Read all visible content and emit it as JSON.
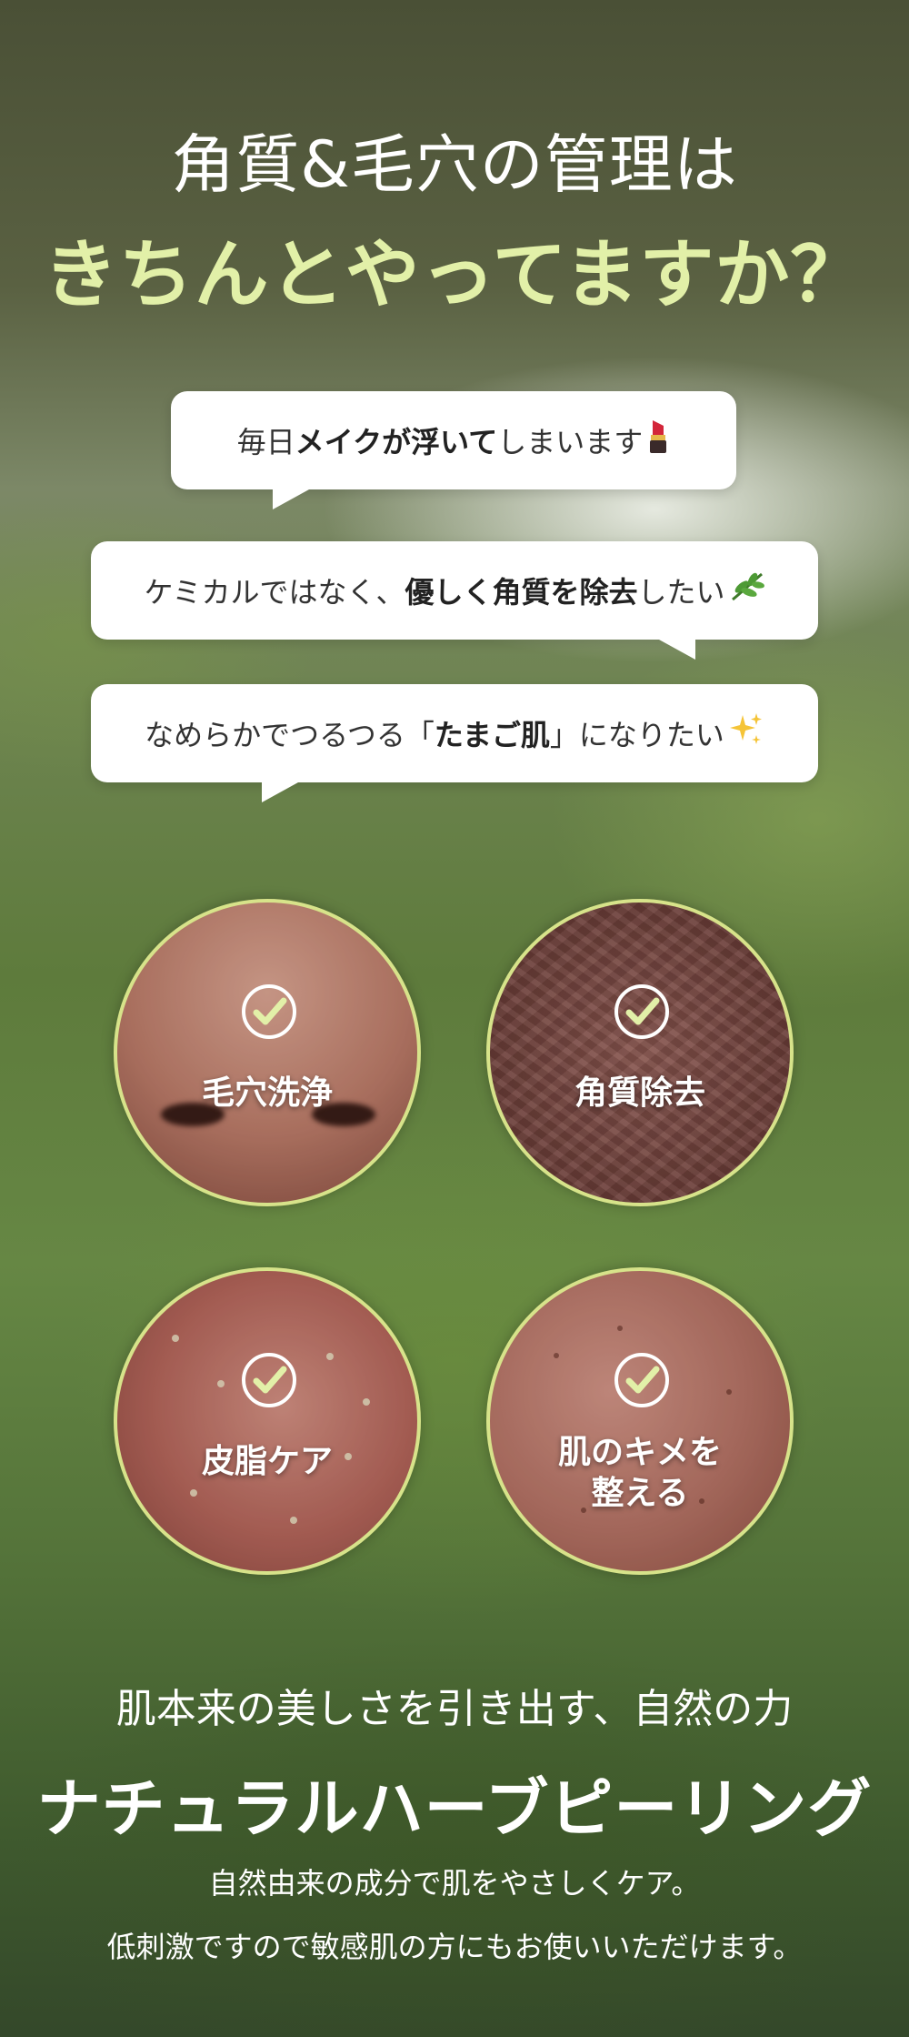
{
  "header": {
    "line1": "角質&毛穴の管理は",
    "line2": "きちんとやってますか？"
  },
  "bubbles": [
    {
      "pre": "毎日",
      "bold": "メイクが浮いて",
      "post": "しまいます",
      "emoji": "lipstick-icon"
    },
    {
      "pre": "ケミカルではなく、",
      "bold": "優しく角質を除去",
      "post": "したい",
      "emoji": "herb-icon"
    },
    {
      "pre": "なめらかでつるつる「",
      "bold": "たまご肌",
      "post": "」になりたい",
      "emoji": "sparkles-icon"
    }
  ],
  "features": [
    {
      "label": "毛穴洗浄"
    },
    {
      "label": "角質除去"
    },
    {
      "label": "皮脂ケア"
    },
    {
      "label_line1": "肌のキメを",
      "label_line2": "整える"
    }
  ],
  "footer": {
    "tagline": "肌本来の美しさを引き出す、自然の力",
    "product": "ナチュラルハーブピーリング",
    "desc1": "自然由来の成分で肌をやさしくケア。",
    "desc2": "低刺激ですので敏感肌の方にもお使いいただけます。"
  },
  "colors": {
    "accent": "#e2f0a8",
    "ring": "#d7e38a"
  }
}
